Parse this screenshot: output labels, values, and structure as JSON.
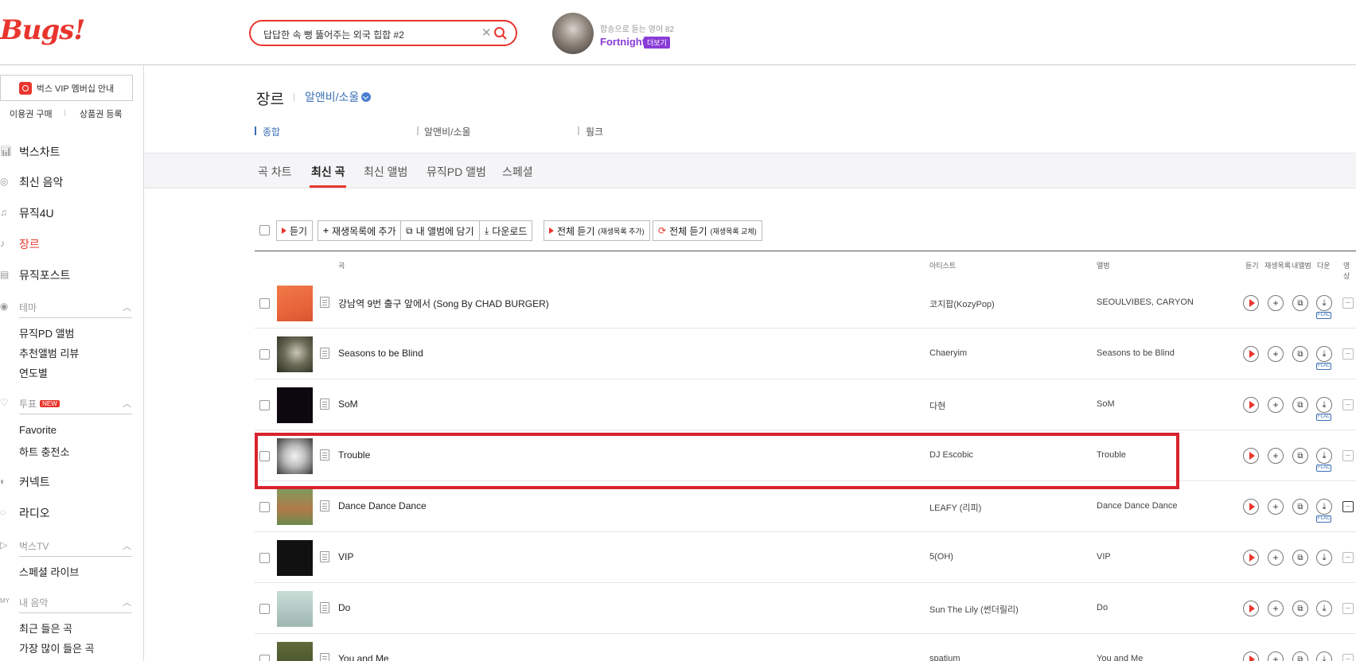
{
  "header": {
    "logo": "Bugs!",
    "search_value": "답답한 속 뻥 뚫어주는 외국 힙합 #2",
    "promo_sub": "합송으로 듣는 영어 82",
    "promo_title": "Fortnight",
    "promo_more": "더보기"
  },
  "sidebar": {
    "vip": "벅스 VIP 멤버십 안내",
    "link_buy": "이용권 구매",
    "link_gift": "상품권 등록",
    "chart": "벅스차트",
    "newmusic": "최신 음악",
    "music4u": "뮤직4U",
    "genre": "장르",
    "musicpost": "뮤직포스트",
    "theme": "테마",
    "theme_items": [
      "뮤직PD 앨범",
      "추천앨범 리뷰",
      "연도별"
    ],
    "vote": "투표",
    "new_badge": "NEW",
    "vote_items": [
      "Favorite",
      "하트 충전소"
    ],
    "connect": "커넥트",
    "radio": "라디오",
    "bugstv": "벅스TV",
    "bugstv_items": [
      "스페셜 라이브"
    ],
    "mymusic": "내 음악",
    "mymusic_items": [
      "최근 들은 곡",
      "가장 많이 들은 곡"
    ]
  },
  "genre": {
    "title": "장르",
    "selected": "알앤비/소울",
    "subgenres": [
      "종합",
      "알앤비/소울",
      "훵크"
    ]
  },
  "tabs": [
    "곡 차트",
    "최신 곡",
    "최신 앨범",
    "뮤직PD 앨범",
    "스페셜"
  ],
  "toolbar": {
    "listen": "듣기",
    "add_playlist": "재생목록에 추가",
    "add_album": "내 앨범에 담기",
    "download": "다운로드",
    "listen_all_add": "전체 듣기",
    "listen_all_add_small": "(재생목록 추가)",
    "listen_all_replace": "전체 듣기",
    "listen_all_replace_small": "(재생목록 교체)"
  },
  "table": {
    "headers": {
      "song": "곡",
      "artist": "아티스트",
      "album": "앨범",
      "listen": "듣기",
      "playlist": "재생목록",
      "myalbum": "내앨범",
      "download": "다운",
      "video": "영상"
    },
    "flac_label": "FLAC",
    "rows": [
      {
        "title": "강남역 9번 출구 앞에서 (Song By CHAD BURGER)",
        "artist": "코지팝(KozyPop)",
        "album": "SEOULVIBES, CARYON",
        "flac": true
      },
      {
        "title": "Seasons to be Blind",
        "artist": "Chaeryim",
        "album": "Seasons to be Blind",
        "flac": true
      },
      {
        "title": "SoM",
        "artist": "다현",
        "album": "SoM",
        "flac": true
      },
      {
        "title": "Trouble",
        "artist": "DJ Escobic",
        "album": "Trouble",
        "flac": true
      },
      {
        "title": "Dance Dance Dance",
        "artist": "LEAFY (리피)",
        "album": "Dance Dance Dance",
        "flac": true
      },
      {
        "title": "VIP",
        "artist": "5(OH)",
        "album": "VIP",
        "flac": false
      },
      {
        "title": "Do",
        "artist": "Sun The Lily (썬더릴리)",
        "album": "Do",
        "flac": false
      },
      {
        "title": "You and Me",
        "artist": "spatium",
        "album": "You and Me",
        "flac": false
      }
    ]
  },
  "colors": {
    "brand": "#e8352d",
    "link": "#3a6fb5",
    "promo": "#8a3cd6",
    "highlight": "#d9232d"
  }
}
